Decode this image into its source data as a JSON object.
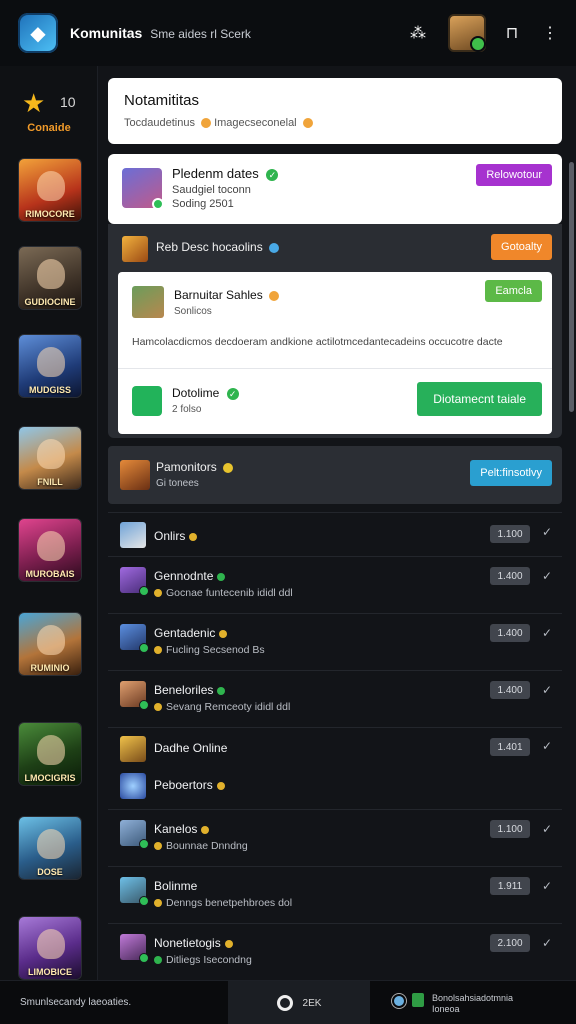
{
  "header": {
    "app_name": "Komunitas",
    "subtitle": "Sme aides rl Scerk"
  },
  "rail": {
    "count": "10",
    "label": "Conaide",
    "games": [
      {
        "label": "RIMOCORE"
      },
      {
        "label": "GUDIOCINE"
      },
      {
        "label": "MUDGISS"
      },
      {
        "label": "FNILL"
      },
      {
        "label": "MUROBAIS"
      },
      {
        "label": "RUMINIO"
      },
      {
        "label": "LMOCIGRIS"
      },
      {
        "label": "DOSE"
      },
      {
        "label": "LIMOBICE"
      }
    ]
  },
  "title_card": {
    "title": "Notamititas",
    "subtitle": "Tocdaudetinus",
    "subtitle2": "Imagecseconelal"
  },
  "event_card": {
    "title": "Pledenm dates",
    "line1": "Saudgiel toconn",
    "line2": "Soding 2501",
    "button": "Relowotour"
  },
  "panel": {
    "header_title": "Reb Desc hocaolins",
    "header_button": "Gotoalty",
    "sub_title": "Barnuitar Sahles",
    "sub_subtitle": "Sonlicos",
    "sub_button": "Eamcla",
    "body": "Hamcolacdicmos decdoeram andkione actilotmcedantecadeins occucotre dacte",
    "item_title": "Dotolime",
    "item_sub": "2 folso",
    "item_button": "Diotamecnt taiale"
  },
  "lfg": {
    "title": "Pamonitors",
    "subtitle": "Gi tonees",
    "button": "Pelt:finsotlvy"
  },
  "list": [
    {
      "title": "Onlirs",
      "sub": "",
      "score": "1.100"
    },
    {
      "title": "Gennodnte",
      "sub": "Gocnae funtecenib ididl ddl",
      "score": "1.400"
    },
    {
      "title": "Gentadenic",
      "sub": "Fucling Secsenod Bs",
      "score": "1.400"
    },
    {
      "title": "Beneloriles",
      "sub": "Sevang Remceoty ididl ddl",
      "score": "1.400"
    },
    {
      "title": "Dadhe Online",
      "sub": "",
      "score": "1.401"
    },
    {
      "title": "Peboertors",
      "sub": "",
      "score": ""
    },
    {
      "title": "Kanelos",
      "sub": "Bounnae Dnndng",
      "score": "1.100"
    },
    {
      "title": "Bolinme",
      "sub": "Denngs benetpehbroes dol",
      "score": "1.911"
    },
    {
      "title": "Nonetietogis",
      "sub": "Ditliegs Isecondng",
      "score": "2.100"
    }
  ],
  "bottom": {
    "left": "Smunlsecandy laeoaties.",
    "mid": "2EK",
    "right1": "Bonolsahsiadotmnia",
    "right2": "Ioneoa"
  }
}
